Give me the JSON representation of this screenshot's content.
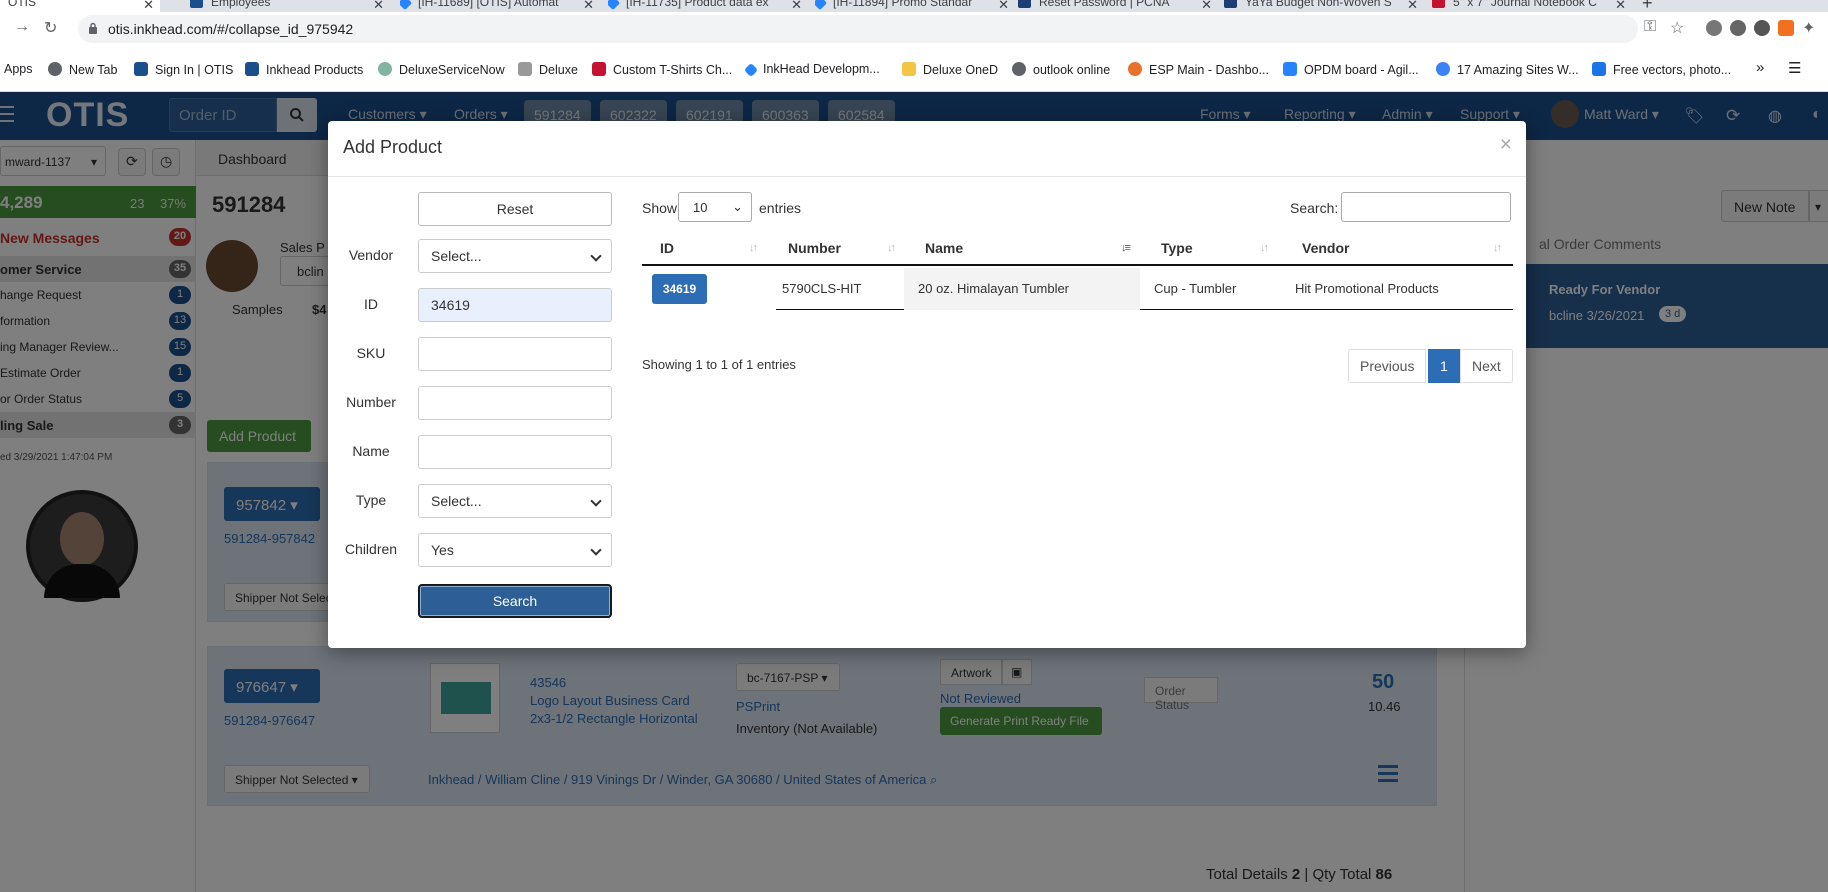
{
  "browser": {
    "tabs": [
      {
        "title": "OTIS",
        "color": "#1b4f8c",
        "active": true
      },
      {
        "title": "Employees",
        "color": "#1b4f8c"
      },
      {
        "title": "[IH-11689] [OTIS] Automat",
        "color": "#2684ff"
      },
      {
        "title": "[IH-11735] Product data ex",
        "color": "#2684ff"
      },
      {
        "title": "[IH-11894] Promo Standar",
        "color": "#2684ff"
      },
      {
        "title": "Reset Password | PCNA",
        "color": "#1d3e74"
      },
      {
        "title": "YaYa Budget Non-Woven S",
        "color": "#1d3e74"
      },
      {
        "title": "5\" x 7\" Journal Notebook C",
        "color": "#c41230"
      }
    ],
    "url": "otis.inkhead.com/#/collapse_id_975942",
    "bookmarks": [
      {
        "label": "Apps",
        "color": "#4285f4"
      },
      {
        "label": "New Tab",
        "color": "#5f6368"
      },
      {
        "label": "Sign In | OTIS",
        "color": "#1b4f8c"
      },
      {
        "label": "Inkhead Products",
        "color": "#1b4f8c"
      },
      {
        "label": "DeluxeServiceNow",
        "color": "#81b5a1"
      },
      {
        "label": "Deluxe",
        "color": "#999999"
      },
      {
        "label": "Custom T-Shirts Ch...",
        "color": "#c41230"
      },
      {
        "label": "InkHead Developm...",
        "color": "#2684ff"
      },
      {
        "label": "Deluxe OneD",
        "color": "#f4c542"
      },
      {
        "label": "outlook online",
        "color": "#5f6368"
      },
      {
        "label": "ESP Main - Dashbo...",
        "color": "#e8712b"
      },
      {
        "label": "OPDM board - Agil...",
        "color": "#2684ff"
      },
      {
        "label": "17 Amazing Sites W...",
        "color": "#3b82f6"
      },
      {
        "label": "Free vectors, photo...",
        "color": "#1a73e8"
      }
    ]
  },
  "app": {
    "logo": "OTIS",
    "order_id_placeholder": "Order ID",
    "menus": [
      "Customers",
      "Orders",
      "Forms",
      "Reporting",
      "Admin",
      "Support"
    ],
    "order_tabs": [
      "591284",
      "602322",
      "602191",
      "600363",
      "602584"
    ],
    "user": "Matt Ward",
    "accent": "#1b4f8c"
  },
  "sidebar": {
    "user_select": "mward-1137",
    "stats": {
      "total": "4,289",
      "count": "23",
      "pct": "37%"
    },
    "messages_label": "New Messages",
    "messages_count": "20",
    "rows": [
      {
        "label": "omer Service",
        "count": "35",
        "bold": true
      },
      {
        "label": "hange Request",
        "count": "1"
      },
      {
        "label": "formation",
        "count": "13"
      },
      {
        "label": "ing Manager Review...",
        "count": "15"
      },
      {
        "label": " Estimate Order",
        "count": "1"
      },
      {
        "label": "or Order Status",
        "count": "5"
      },
      {
        "label": "ling Sale",
        "count": "3",
        "bold": true
      }
    ],
    "updated": "ed 3/29/2021 1:47:04 PM"
  },
  "main": {
    "dashboard_tab": "Dashboard",
    "order_number": "591284",
    "sales_label": "Sales P",
    "sales_value": "bclin",
    "samples_label": "Samples",
    "samples_value": "$4",
    "add_product_label": "Add Product",
    "card1": {
      "id": "957842",
      "sub": "591284-957842",
      "shipper": "Shipper Not Selec"
    },
    "card2": {
      "id": "976647",
      "sub": "591284-976647",
      "product_num": "43546",
      "product_name_1": "Logo Layout Business Card",
      "product_name_2": "2x3-1/2 Rectangle Horizontal",
      "vendor_code": "bc-7167-PSP",
      "vendor": "PSPrint",
      "inventory": "Inventory (Not Available)",
      "artwork": "Artwork",
      "review": "Not Reviewed",
      "generate": "Generate Print Ready File",
      "order_status": "Order Status",
      "qty": "50",
      "price": "10.46",
      "shipper": "Shipper Not Selected",
      "address": "Inkhead / William Cline / 919 Vinings Dr / Winder,  GA  30680 / United States of America"
    },
    "totals_label": "Total Details",
    "totals_value": "2",
    "qty_total_label": "| Qty Total",
    "qty_total_value": "86"
  },
  "right": {
    "new_note": "New Note",
    "comments_label": "al Order Comments",
    "note_title": "Ready For Vendor",
    "note_meta": "bcline 3/26/2021",
    "note_age": "3 d"
  },
  "modal": {
    "title": "Add Product",
    "close": "×",
    "reset_label": "Reset",
    "fields": {
      "vendor_label": "Vendor",
      "vendor_value": "Select...",
      "id_label": "ID",
      "id_value": "34619",
      "sku_label": "SKU",
      "sku_value": "",
      "number_label": "Number",
      "number_value": "",
      "name_label": "Name",
      "name_value": "",
      "type_label": "Type",
      "type_value": "Select...",
      "children_label": "Children",
      "children_value": "Yes"
    },
    "search_label": "Search",
    "table": {
      "show_label": "Show",
      "entries_value": "10",
      "entries_label": "entries",
      "search_label": "Search:",
      "columns": [
        "ID",
        "Number",
        "Name",
        "Type",
        "Vendor"
      ],
      "rows": [
        {
          "id": "34619",
          "number": "5790CLS-HIT",
          "name": "20 oz. Himalayan Tumbler",
          "type": "Cup - Tumbler",
          "vendor": "Hit Promotional Products"
        }
      ],
      "info": "Showing 1 to 1 of 1 entries",
      "prev": "Previous",
      "page": "1",
      "next": "Next"
    }
  }
}
